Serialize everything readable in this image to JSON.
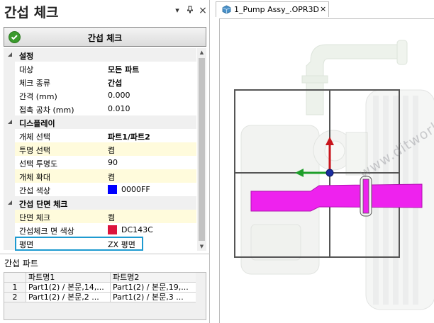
{
  "panel": {
    "title": "간섭 체크",
    "pin_glyph": "▾",
    "dock_glyph": "ᵖ",
    "close_glyph": "×"
  },
  "check_button": {
    "label": "간섭 체크"
  },
  "properties": {
    "settings": {
      "label": "설정",
      "rows": [
        {
          "name": "대상",
          "value": "모든 파트"
        },
        {
          "name": "체크 종류",
          "value": "간섭"
        },
        {
          "name": "간격 (mm)",
          "value": "0.000"
        },
        {
          "name": "접촉 공차 (mm)",
          "value": "0.010"
        }
      ]
    },
    "display": {
      "label": "디스플레이",
      "rows": [
        {
          "name": "개체 선택",
          "value": "파트1/파트2"
        },
        {
          "name": "투명 선택",
          "value": "켬"
        },
        {
          "name": "선택 투명도",
          "value": "90"
        },
        {
          "name": "개체 확대",
          "value": "켬"
        },
        {
          "name": "간섭 색상",
          "value": "0000FF",
          "color": "#0000FF"
        }
      ]
    },
    "section": {
      "label": "간섭 단면 체크",
      "rows": [
        {
          "name": "단면 체크",
          "value": "켬"
        },
        {
          "name": "간섭체크 면 색상",
          "value": "DC143C",
          "color": "#DC143C"
        },
        {
          "name": "평면",
          "value": "ZX 평면"
        }
      ]
    }
  },
  "parts": {
    "label": "간섭 파트",
    "columns": [
      "",
      "파트명1",
      "파트명2"
    ],
    "rows": [
      {
        "index": "1",
        "part1": "Part1(2) / 본문,14,...",
        "part2": "Part1(2) / 본문,19,..."
      },
      {
        "index": "2",
        "part1": "Part1(2) / 본문,2 ...",
        "part2": "Part1(2) / 본문,3 ..."
      }
    ]
  },
  "document_tab": {
    "label": "1_Pump Assy_.OPR3D",
    "close": "×"
  },
  "watermark": "www.ditworks.com",
  "colors": {
    "accent": "#1e9ad0",
    "interference": "#0000FF",
    "section_face": "#DC143C",
    "highlight_row": "#fffbdc",
    "pipe_magenta": "#ee22ee"
  }
}
